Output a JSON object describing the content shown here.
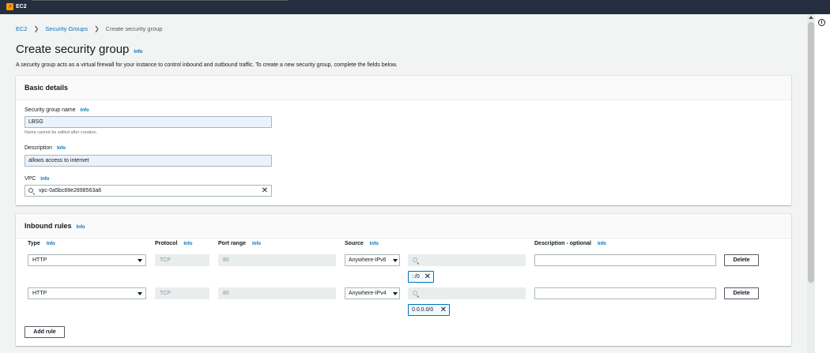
{
  "app": {
    "title": "EC2",
    "accent_color": "#ff9900",
    "logo_glyph": "↗"
  },
  "breadcrumb": {
    "item_1": "EC2",
    "item_2": "Security Groups",
    "current": "Create security group",
    "separator": "❯"
  },
  "page": {
    "title": "Create security group",
    "info": "Info",
    "description": "A security group acts as a virtual firewall for your instance to control inbound and outbound traffic. To create a new security group, complete the fields below."
  },
  "header": {
    "help_icon_glyph": "i"
  },
  "basic": {
    "title": "Basic details",
    "name_label": "Security group name",
    "name_value": "LBSG",
    "name_hint": "Name cannot be edited after creation.",
    "description_label": "Description",
    "description_value": "allows access to internet",
    "vpc_label": "VPC",
    "vpc_value": "vpc-0a5bc88e2898563a8",
    "info": "Info",
    "clear_glyph": "✕"
  },
  "inbound": {
    "title": "Inbound rules",
    "info": "Info",
    "columns": {
      "type": "Type",
      "protocol": "Protocol",
      "port_range": "Port range",
      "source": "Source",
      "description": "Description - optional"
    },
    "rules": [
      {
        "type": "HTTP",
        "protocol": "TCP",
        "port": "80",
        "source": "Anywhere-IPv6",
        "cidr": "::/0",
        "delete": "Delete"
      },
      {
        "type": "HTTP",
        "protocol": "TCP",
        "port": "80",
        "source": "Anywhere-IPv4",
        "cidr": "0.0.0.0/0",
        "delete": "Delete"
      }
    ],
    "add_rule": "Add rule",
    "remove_glyph": "✕"
  }
}
